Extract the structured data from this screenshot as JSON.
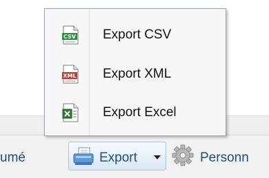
{
  "toolbar": {
    "resume_label": "umé",
    "export_label": "Export",
    "personalize_label": "Personn"
  },
  "menu": {
    "items": [
      {
        "label": "Export CSV",
        "icon": "csv-file-icon",
        "icon_text": "CSV",
        "color": "#2e8b3a"
      },
      {
        "label": "Export XML",
        "icon": "xml-file-icon",
        "icon_text": "XML",
        "color": "#c0392b"
      },
      {
        "label": "Export Excel",
        "icon": "excel-file-icon",
        "icon_text": "",
        "color": "#2f7d32"
      }
    ]
  },
  "colors": {
    "toolbar_text": "#1f4e79",
    "menu_text": "#111111",
    "menu_border": "#9aa3ad"
  }
}
